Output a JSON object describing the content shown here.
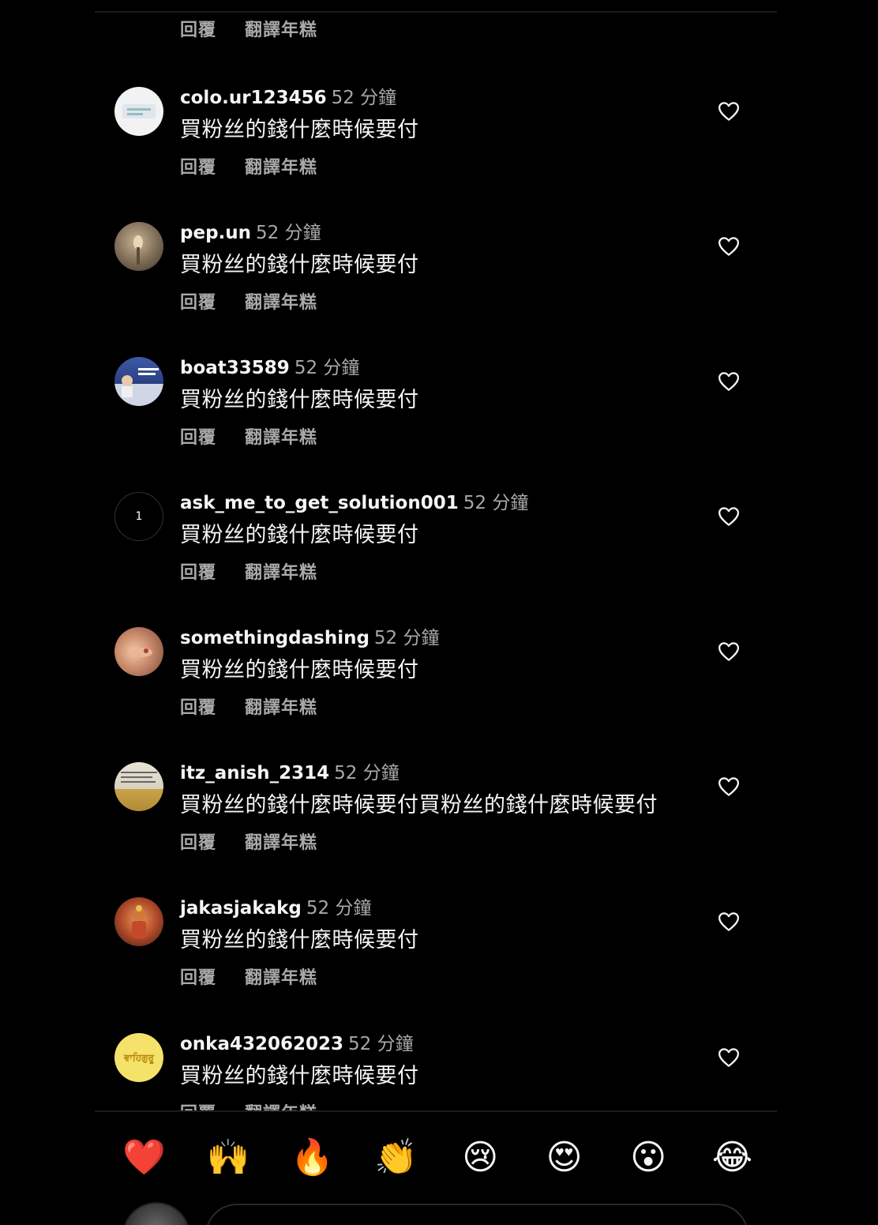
{
  "labels": {
    "reply": "回覆",
    "translate": "翻譯年糕"
  },
  "emoji_bar": [
    "❤️",
    "🙌",
    "🔥",
    "👏",
    "😢",
    "😍",
    "😮",
    "😂"
  ],
  "comments": [
    {
      "username": "colo.ur123456",
      "time": "52 分鐘",
      "text": "買粉丝的錢什麼時候要付"
    },
    {
      "username": "pep.un",
      "time": "52 分鐘",
      "text": "買粉丝的錢什麼時候要付"
    },
    {
      "username": "boat33589",
      "time": "52 分鐘",
      "text": "買粉丝的錢什麼時候要付"
    },
    {
      "username": "ask_me_to_get_solution001",
      "time": "52 分鐘",
      "text": "買粉丝的錢什麼時候要付",
      "avatar_text": "1"
    },
    {
      "username": "somethingdashing",
      "time": "52 分鐘",
      "text": "買粉丝的錢什麼時候要付"
    },
    {
      "username": "itz_anish_2314",
      "time": "52 分鐘",
      "text": "買粉丝的錢什麼時候要付買粉丝的錢什麼時候要付"
    },
    {
      "username": "jakasjakakg",
      "time": "52 分鐘",
      "text": "買粉丝的錢什麼時候要付"
    },
    {
      "username": "onka432062023",
      "time": "52 分鐘",
      "text": "買粉丝的錢什麼時候要付",
      "avatar_text": "ਵਾਹਿਗੁਰੂ"
    }
  ],
  "colors": {
    "background": "#000000",
    "text_primary": "#f5f5f5",
    "text_secondary": "#a8a8a8"
  }
}
